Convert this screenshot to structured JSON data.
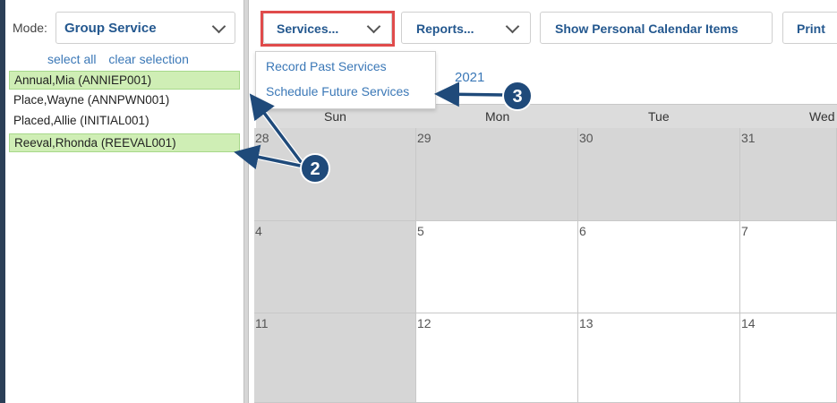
{
  "mode": {
    "label": "Mode:",
    "value": "Group Service"
  },
  "selection_links": {
    "select_all": "select all",
    "clear": "clear selection"
  },
  "clients": [
    {
      "name": "Annual,Mia (ANNIEP001)",
      "selected": true
    },
    {
      "name": "Place,Wayne (ANNPWN001)",
      "selected": false
    },
    {
      "name": "Placed,Allie (INITIAL001)",
      "selected": false
    },
    {
      "name": "Reeval,Rhonda (REEVAL001)",
      "selected": true
    }
  ],
  "toolbar": {
    "services": "Services...",
    "reports": "Reports...",
    "show_personal": "Show Personal Calendar Items",
    "print": "Print"
  },
  "services_menu": {
    "record_past": "Record Past Services",
    "schedule_future": "Schedule Future Services"
  },
  "calendar": {
    "title_fragment": "2021",
    "days": [
      "Sun",
      "Mon",
      "Tue",
      "Wed"
    ],
    "weeks": [
      [
        "28",
        "29",
        "30",
        "31"
      ],
      [
        "4",
        "5",
        "6",
        "7"
      ],
      [
        "11",
        "12",
        "13",
        "14"
      ]
    ]
  },
  "callouts": {
    "two": "2",
    "three": "3"
  },
  "colors": {
    "accent": "#24588f",
    "link": "#3b78b7",
    "selected_bg": "#cfeeb5",
    "highlight": "#e04b4b",
    "callout": "#1f4a7a"
  }
}
